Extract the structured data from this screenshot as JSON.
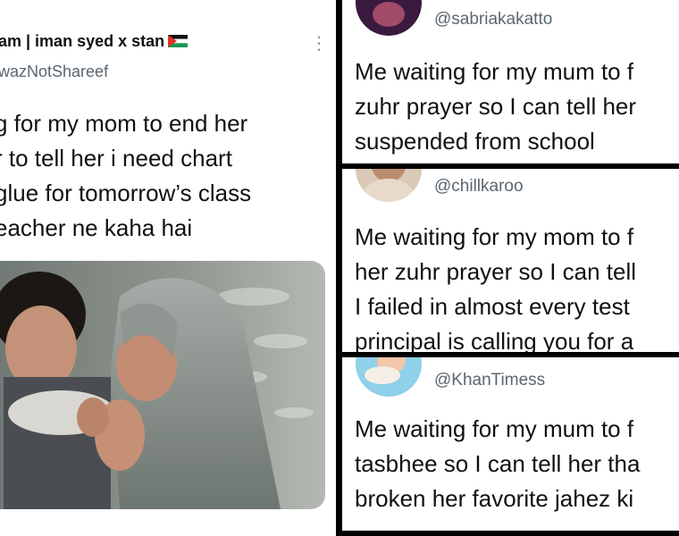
{
  "left_tweet": {
    "display_name": "am | iman syed x stan",
    "handle": "wazNotShareef",
    "more_icon": "more-vertical-icon",
    "lines": [
      "g for my mom to end her",
      "r to tell her i need chart",
      "glue for tomorrow’s class",
      "eacher ne kaha hai"
    ]
  },
  "tweets": [
    {
      "handle": "@sabriakakatto",
      "lines": [
        "Me waiting for my mum to f",
        "zuhr prayer so I can tell her",
        "suspended from school"
      ]
    },
    {
      "handle": "@chillkaroo",
      "lines": [
        "Me waiting for my mom to f",
        "her zuhr prayer so I can tell",
        "I failed in almost every test",
        "principal is calling you for a"
      ]
    },
    {
      "handle": "@KhanTimess",
      "lines": [
        "Me waiting for my mum to f",
        "tasbhee so I can tell her tha",
        "broken her favorite jahez ki"
      ]
    }
  ]
}
